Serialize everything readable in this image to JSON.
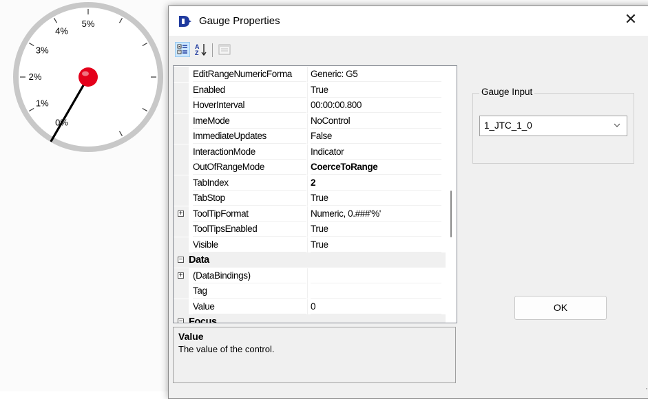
{
  "gauge": {
    "ticks": [
      "0%",
      "1%",
      "2%",
      "3%",
      "4%",
      "5%"
    ],
    "value_percent": 0,
    "needle_color": "#e4001b"
  },
  "dialog": {
    "title": "Gauge Properties",
    "close_glyph": "✕",
    "icon": "app-logo-icon"
  },
  "toolbar": {
    "buttons": [
      "categorized-icon",
      "alphabetical-sort-icon",
      "property-pages-icon"
    ]
  },
  "grid": {
    "rows": [
      {
        "name": "EditRangeNumericForma",
        "value": "Generic: G5"
      },
      {
        "name": "Enabled",
        "value": "True"
      },
      {
        "name": "HoverInterval",
        "value": "00:00:00.800"
      },
      {
        "name": "ImeMode",
        "value": "NoControl"
      },
      {
        "name": "ImmediateUpdates",
        "value": "False"
      },
      {
        "name": "InteractionMode",
        "value": "Indicator"
      },
      {
        "name": "OutOfRangeMode",
        "value": "CoerceToRange"
      },
      {
        "name": "TabIndex",
        "value": "2"
      },
      {
        "name": "TabStop",
        "value": "True"
      },
      {
        "name": "ToolTipFormat",
        "value": "Numeric, 0.###'%'"
      },
      {
        "name": "ToolTipsEnabled",
        "value": "True"
      },
      {
        "name": "Visible",
        "value": "True"
      },
      {
        "name": "Data",
        "value": ""
      },
      {
        "name": "(DataBindings)",
        "value": ""
      },
      {
        "name": "Tag",
        "value": ""
      },
      {
        "name": "Value",
        "value": "0"
      },
      {
        "name": "Focus",
        "value": ""
      }
    ],
    "expand_glyph": "+",
    "collapse_glyph": "−"
  },
  "help": {
    "title": "Value",
    "description": "The value of the control."
  },
  "gauge_input": {
    "label": "Gauge Input",
    "selected": "1_JTC_1_0"
  },
  "ok_label": "OK",
  "colors": {
    "selection": "#cde8ff",
    "category_bg": "#f0f0f0",
    "logo": "#1f3a9e"
  }
}
